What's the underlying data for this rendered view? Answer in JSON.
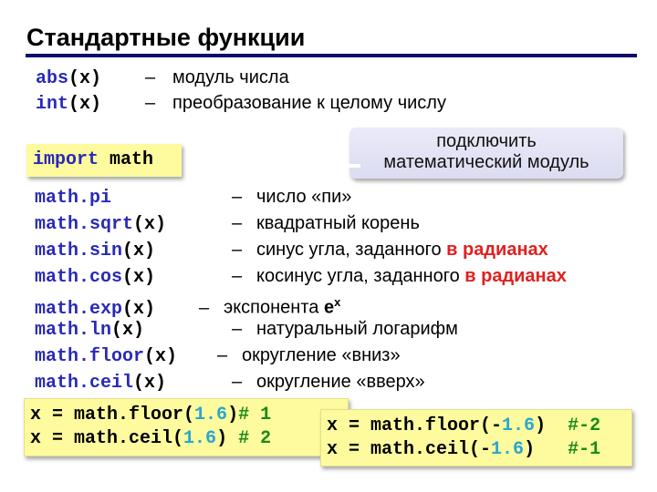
{
  "title": "Стандартные функции",
  "builtins": [
    {
      "fn": "abs",
      "arg": "(x)",
      "dash": "–",
      "desc": "модуль числа"
    },
    {
      "fn": "int",
      "arg": "(x)",
      "dash": "–",
      "desc": "преобразование к целому числу"
    }
  ],
  "import": {
    "keyword": "import",
    "module": "math"
  },
  "callout": {
    "line1": "подключить",
    "line2": "математический модуль"
  },
  "math_functions": [
    {
      "fn": "math.pi",
      "arg": "",
      "dash": "–",
      "desc": "число «пи»",
      "highlight": ""
    },
    {
      "fn": "math.sqrt",
      "arg": "(x)",
      "dash": "–",
      "desc": "квадратный корень",
      "highlight": ""
    },
    {
      "fn": "math.sin",
      "arg": "(x)",
      "dash": "–",
      "desc": "синус угла, заданного ",
      "highlight": "в радианах"
    },
    {
      "fn": "math.cos",
      "arg": "(x)",
      "dash": "–",
      "desc": "косинус угла, заданного ",
      "highlight": "в радианах"
    },
    {
      "fn": "math.exp",
      "arg": "(x)",
      "dash": "–",
      "desc": "экспонента ",
      "highlight": "",
      "exp_base": "e",
      "exp_power": "x"
    },
    {
      "fn": "math.ln",
      "arg": "(x)",
      "dash": "–",
      "desc": "натуральный логарифм",
      "highlight": ""
    },
    {
      "fn": "math.floor",
      "arg": "(x)",
      "dash": "–",
      "desc": "округление «вниз»",
      "highlight": ""
    },
    {
      "fn": "math.ceil",
      "arg": "(x)",
      "dash": "–",
      "desc": "округление «вверх»",
      "highlight": ""
    }
  ],
  "examples_positive": [
    {
      "lhs": "x = ",
      "call": "math.floor(",
      "num": "1.6",
      "close": ")",
      "comment": "# 1"
    },
    {
      "lhs": "x = ",
      "call": "math.ceil(",
      "num": "1.6",
      "close": ") ",
      "comment": "# 2"
    }
  ],
  "examples_negative": [
    {
      "lhs": "x = ",
      "call": "math.floor(-",
      "num": "1.6",
      "close": ")  ",
      "comment": "#-2"
    },
    {
      "lhs": "x = ",
      "call": "math.ceil(-",
      "num": "1.6",
      "close": ")   ",
      "comment": "#-1"
    }
  ],
  "colors": {
    "title_rule": "#0c0c6b",
    "function_blue": "#2929b8",
    "highlight_red": "#e02020",
    "number_cyan": "#2aa6cf",
    "comment_green": "#1a8a1a",
    "code_box_yellow": "#fdfb9e",
    "callout_lavender": "#e3e3f5"
  }
}
